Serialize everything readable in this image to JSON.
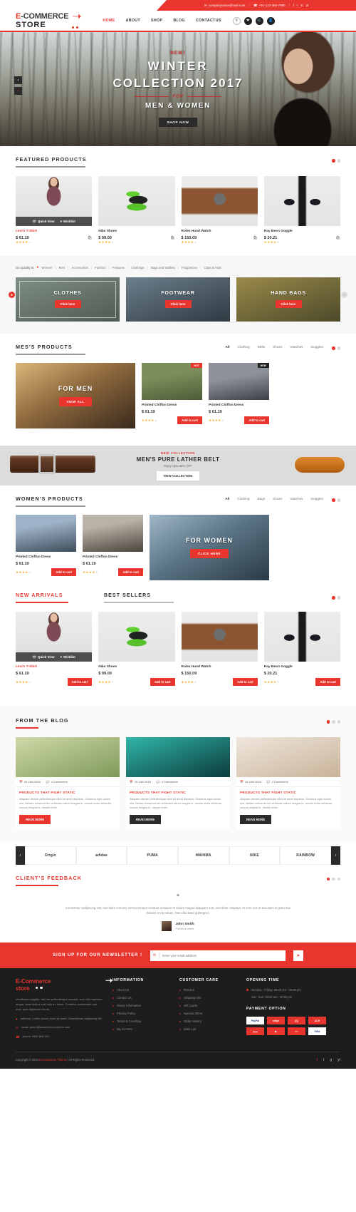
{
  "topbar": {
    "email": "companyname@mail.com",
    "phone": "+91-123-456-7890",
    "sep": "/",
    "social": [
      "f",
      "t",
      "in",
      "yt"
    ]
  },
  "header": {
    "logo_line1_accent": "E",
    "logo_line1": "-COMMERCE",
    "logo_line2": "STORE",
    "nav": [
      {
        "label": "HOME",
        "active": true
      },
      {
        "label": "ABOUT",
        "active": false
      },
      {
        "label": "SHOP",
        "active": false
      },
      {
        "label": "BLOG",
        "active": false
      },
      {
        "label": "CONTACTUS",
        "active": false
      }
    ],
    "icons": [
      "search-icon",
      "heart-icon",
      "cart-icon",
      "user-icon"
    ]
  },
  "hero": {
    "kicker": "NEW!",
    "title1": "WINTER",
    "title2": "COLLECTION 2017",
    "for": "FOR",
    "title3": "MEN & WOMEN",
    "button": "SHOP NOW",
    "prev": "‹",
    "next": "›"
  },
  "featured": {
    "title": "FEATURED PRODUCTS",
    "hover": {
      "quick_view": "Quick View",
      "wishlist": "Wishlist"
    },
    "products": [
      {
        "name": "Levi's T-Shirt",
        "price": "$ 61.19",
        "stars": 4,
        "accent": true,
        "img": "ph-shirt"
      },
      {
        "name": "Nike Shoes",
        "price": "$ 99.00",
        "stars": 4,
        "accent": false,
        "img": "ph-shoe"
      },
      {
        "name": "Rolex Hand Watch",
        "price": "$ 150.09",
        "stars": 4,
        "accent": false,
        "img": "ph-watch"
      },
      {
        "name": "Ray Beon Goggle",
        "price": "$ 20.21",
        "stars": 4,
        "accent": false,
        "img": "ph-goggle"
      }
    ]
  },
  "quicklinks": {
    "label": "Go quickly to",
    "items": [
      "Women",
      "Men",
      "Accessories",
      "Fashion",
      "Features",
      "Clothings",
      "Bags and Wallets",
      "Fragrances",
      "Caps & Hats"
    ]
  },
  "tiles": [
    {
      "title": "CLOTHES",
      "button": "Click here"
    },
    {
      "title": "FOOTWEAR",
      "button": "Click here"
    },
    {
      "title": "HAND BAGS",
      "button": "Click here"
    }
  ],
  "mens": {
    "title": "MES'S PRODUCTS",
    "tabs": [
      "All",
      "Clothing",
      "Belts",
      "Shoes",
      "Watches",
      "Goggles"
    ],
    "feature": {
      "title": "FOR MEN",
      "button": "VIEW ALL"
    },
    "products": [
      {
        "name": "Printed Chiffon Dress",
        "price": "$ 61.19",
        "stars": 4,
        "badge": "HOT",
        "badge_dark": false,
        "cart": "Add to cart",
        "img": "ph-jeans"
      },
      {
        "name": "Printed Chiffon Dress",
        "price": "$ 61.19",
        "stars": 4,
        "badge": "NEW",
        "badge_dark": true,
        "cart": "Add to cart",
        "img": "ph-urban"
      }
    ]
  },
  "belt": {
    "kicker": "NEW COLLECTION",
    "title": "MEN'S PURE LATHER BELT",
    "sub": "Enjoy Upto 30% OFF",
    "button": "VIEW COLLECTION"
  },
  "womens": {
    "title": "WOMEN'S PRODUCTS",
    "tabs": [
      "All",
      "Clothing",
      "Bags",
      "Shoes",
      "Watches",
      "Goggles"
    ],
    "feature": {
      "title": "FOR WOMEN",
      "button": "CLICK HERE"
    },
    "products": [
      {
        "name": "Printed Chiffon Dress",
        "price": "$ 61.19",
        "stars": 4,
        "cart": "Add to cart",
        "img": "ph-w1"
      },
      {
        "name": "Printed Chiffon Dress",
        "price": "$ 61.19",
        "stars": 4,
        "cart": "Add to cart",
        "img": "ph-w2"
      }
    ]
  },
  "arrivals": {
    "tab1": "NEW ARRIVALS",
    "tab2": "BEST SELLERS",
    "hover": {
      "quick_view": "Quick View",
      "wishlist": "Wishlist"
    },
    "products": [
      {
        "name": "Levi's T-Shirt",
        "price": "$ 61.19",
        "stars": 4,
        "accent": true,
        "cart": "Add to cart",
        "img": "ph-shirt"
      },
      {
        "name": "Nike Shoes",
        "price": "$ 99.00",
        "stars": 4,
        "accent": false,
        "cart": "Add to cart",
        "img": "ph-shoe"
      },
      {
        "name": "Rolex Hand Watch",
        "price": "$ 150.09",
        "stars": 4,
        "accent": false,
        "cart": "Add to cart",
        "img": "ph-watch"
      },
      {
        "name": "Ray Beon Goggle",
        "price": "$ 20.21",
        "stars": 4,
        "accent": false,
        "cart": "Add to cart",
        "img": "ph-goggle"
      }
    ]
  },
  "blog": {
    "title": "FROM THE BLOG",
    "posts": [
      {
        "date": "15 JAN 2018",
        "comments": "4 Comments",
        "title": "PRODUCTS THAT FIGHT STATIC",
        "text": "Aliquam dictum pellentesque nibh sit amet dapibus. Vivamus eget luctus nisl. Nullam euismod leo vehicula rutrum magna in, ornare enim vehicula, cursus magna in, ornare enim.",
        "button": "READ MORE",
        "dark": false,
        "img": "bi1"
      },
      {
        "date": "15 JAN 2018",
        "comments": "4 Comments",
        "title": "PRODUCTS THAT FIGHT STATIC",
        "text": "Aliquam dictum pellentesque nibh sit amet dapibus. Vivamus eget luctus nisl. Nullam euismod leo vehicula rutrum magna in, ornare enim vehicula, cursus magna in, ornare enim.",
        "button": "READ MORE",
        "dark": true,
        "img": "bi2"
      },
      {
        "date": "15 JAN 2018",
        "comments": "4 Comments",
        "title": "PRODUCTS THAT FIGHT STATIC",
        "text": "Aliquam dictum pellentesque nibh sit amet dapibus. Vivamus eget luctus nisl. Nullam euismod leo vehicula rutrum magna in, ornare enim vehicula, cursus magna in, ornare enim.",
        "button": "READ MORE",
        "dark": true,
        "img": "bi3"
      }
    ]
  },
  "brands": {
    "prev": "‹",
    "next": "›",
    "items": [
      "Origin",
      "adidas",
      "PUMA",
      "MAHIMA",
      "NIKE",
      "RAINBOW"
    ]
  },
  "feedback": {
    "title": "CLIENT'S FEEDBACK",
    "quote": "”",
    "text": "Consetetur sadipscing elitr, sed diam nonumy eirmod tempor invidunt ut labore et dolore magna aliquyam erat, sed diam voluptua. At vero eos et accusam et justo duo dolores et ea rebum. Stet clita kasd gubergren.",
    "author": "John Smith",
    "role": "Furniture client"
  },
  "newsletter": {
    "title": "SIGN UP FOR OUR NEWSLETTER !",
    "placeholder": "Enter your email address",
    "button": "➤"
  },
  "footer": {
    "logo1": "E-Commerce",
    "logo2": "store",
    "about": "Vestibulum sagittis, nisl nec pellentesque suscipit, arcu nisl maximus neque, vitae finibus erat odio eu lacus. Curabitur malesuada erat eros, quis dignissim dui ac.",
    "address": "address: Lorem ipsum dolor sit amet, Onsectetuer adipiscing elit",
    "email": "email: demo@ecommercethemes.com",
    "phone": "phone: 0987.654.321",
    "col2": {
      "head": "INFORMATION",
      "items": [
        "About Us",
        "Contact Us",
        "Divery Information",
        "Privacy Policy",
        "Terms & Condition",
        "My Account"
      ]
    },
    "col3": {
      "head": "CUSTOMER CARE",
      "items": [
        "Returns",
        "Shipping Info",
        "Gift Cards",
        "Special Offers",
        "Order History",
        "Wish List"
      ]
    },
    "col4": {
      "head": "OPENING TIME",
      "line1": "Monday - Friday: 08:30 am - 09:30 pm",
      "line2": "Sat - Sun: 09:00 am - 10:00 pm",
      "pay_head": "PAYMENT OPTION",
      "pay": [
        "PayPal",
        "stripe",
        "(())",
        "ACH",
        "▬▬",
        "▶",
        "≡≡",
        "VISA"
      ]
    },
    "copyright_pre": "Copyright © 2018 ",
    "copyright_brand": "E-Commerce Theme",
    "copyright_post": " | All Rights Reserved.",
    "social": [
      "f",
      "t",
      "g",
      "yt"
    ]
  }
}
